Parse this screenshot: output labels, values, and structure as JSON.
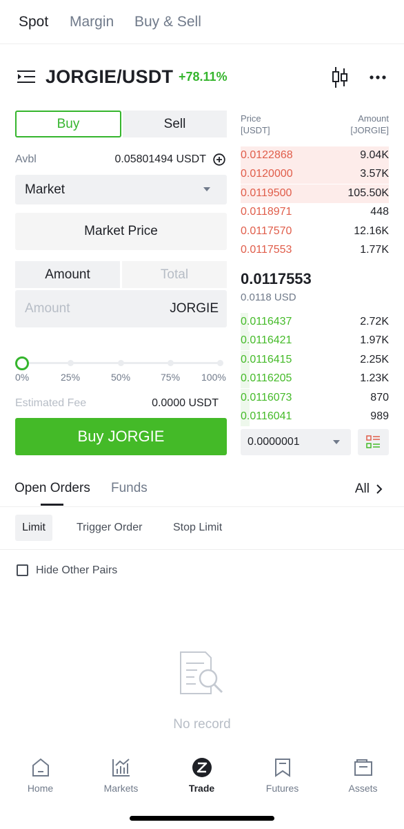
{
  "top_tabs": [
    "Spot",
    "Margin",
    "Buy & Sell"
  ],
  "pair": {
    "name": "JORGIE/USDT",
    "change": "+78.11%"
  },
  "trade": {
    "buy_label": "Buy",
    "sell_label": "Sell",
    "avbl_label": "Avbl",
    "avbl_value": "0.05801494 USDT",
    "order_type": "Market",
    "market_price_label": "Market Price",
    "amount_toggle": "Amount",
    "total_toggle": "Total",
    "amount_placeholder": "Amount",
    "amount_unit": "JORGIE",
    "slider_labels": [
      "0%",
      "25%",
      "50%",
      "75%",
      "100%"
    ],
    "slider_value_percent": 0,
    "fee_label": "Estimated Fee",
    "fee_value": "0.0000 USDT",
    "buy_button": "Buy JORGIE"
  },
  "orderbook": {
    "price_header": [
      "Price",
      "[USDT]"
    ],
    "amount_header": [
      "Amount",
      "[JORGIE]"
    ],
    "asks": [
      {
        "price": "0.0122868",
        "amount": "9.04K",
        "depth": 1.0
      },
      {
        "price": "0.0120000",
        "amount": "3.57K",
        "depth": 1.0
      },
      {
        "price": "0.0119500",
        "amount": "105.50K",
        "depth": 1.0
      },
      {
        "price": "0.0118971",
        "amount": "448",
        "depth": 0
      },
      {
        "price": "0.0117570",
        "amount": "12.16K",
        "depth": 0
      },
      {
        "price": "0.0117553",
        "amount": "1.77K",
        "depth": 0
      }
    ],
    "last_price": "0.0117553",
    "last_price_usd": "0.0118 USD",
    "bids": [
      {
        "price": "0.0116437",
        "amount": "2.72K",
        "depth": 0.05
      },
      {
        "price": "0.0116421",
        "amount": "1.97K",
        "depth": 0.06
      },
      {
        "price": "0.0116415",
        "amount": "2.25K",
        "depth": 0.06
      },
      {
        "price": "0.0116205",
        "amount": "1.23K",
        "depth": 0.06
      },
      {
        "price": "0.0116073",
        "amount": "870",
        "depth": 0.06
      },
      {
        "price": "0.0116041",
        "amount": "989",
        "depth": 0.06
      }
    ],
    "precision": "0.0000001"
  },
  "orders": {
    "tabs": [
      "Open Orders",
      "Funds"
    ],
    "all_label": "All",
    "subtabs": [
      "Limit",
      "Trigger Order",
      "Stop Limit"
    ],
    "hide_other_pairs": "Hide Other Pairs",
    "empty_text": "No record"
  },
  "nav": [
    {
      "label": "Home",
      "icon": "home-icon"
    },
    {
      "label": "Markets",
      "icon": "markets-icon"
    },
    {
      "label": "Trade",
      "icon": "trade-icon"
    },
    {
      "label": "Futures",
      "icon": "futures-icon"
    },
    {
      "label": "Assets",
      "icon": "assets-icon"
    }
  ],
  "colors": {
    "accent_green": "#44ba28",
    "ask_red": "#e05d4a"
  }
}
